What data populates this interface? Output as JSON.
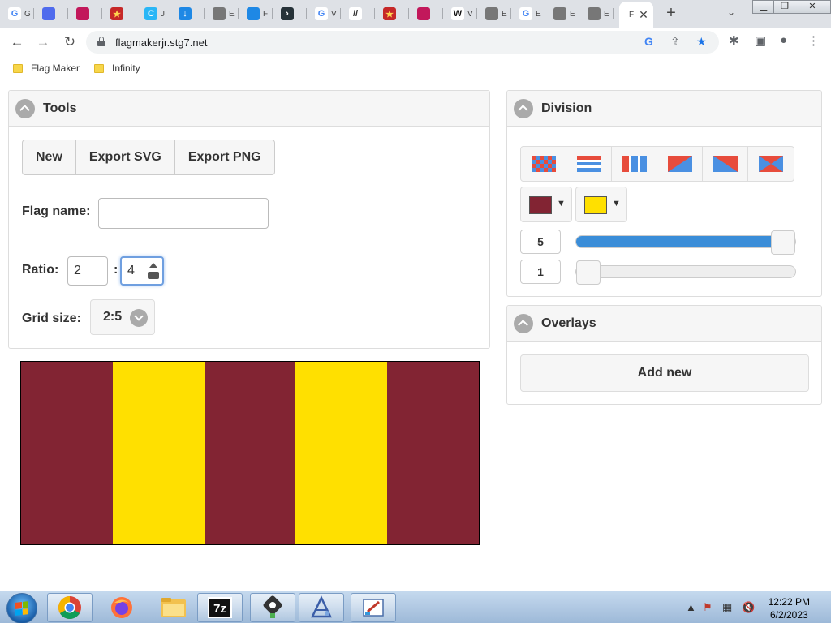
{
  "browser": {
    "tabs": [
      {
        "icon": "google-icon",
        "letter": "G",
        "label": "G",
        "color": "#ffffff",
        "fg": "#4285f4"
      },
      {
        "icon": "teams-icon",
        "letter": "",
        "label": "",
        "color": "#4f6bed",
        "fg": "#ffffff"
      },
      {
        "icon": "tab-icon",
        "letter": "",
        "label": "",
        "color": "#c2185b",
        "fg": "#ffffff"
      },
      {
        "icon": "star-icon",
        "letter": "★",
        "label": "",
        "color": "#c62828",
        "fg": "#ffd54f"
      },
      {
        "icon": "c-icon",
        "letter": "C",
        "label": "J",
        "color": "#29b6f6",
        "fg": "#ffffff"
      },
      {
        "icon": "download-icon",
        "letter": "↓",
        "label": "",
        "color": "#1e88e5",
        "fg": "#ffffff"
      },
      {
        "icon": "globe-icon",
        "letter": "",
        "label": "E",
        "color": "#777777",
        "fg": "#ffffff"
      },
      {
        "icon": "edge-icon",
        "letter": "",
        "label": "F",
        "color": "#1e88e5",
        "fg": "#ffffff"
      },
      {
        "icon": "arrow-icon",
        "letter": "›",
        "label": "",
        "color": "#263238",
        "fg": "#ffffff"
      },
      {
        "icon": "google-icon",
        "letter": "G",
        "label": "V",
        "color": "#ffffff",
        "fg": "#4285f4"
      },
      {
        "icon": "slash-icon",
        "letter": "//",
        "label": "",
        "color": "#ffffff",
        "fg": "#333333"
      },
      {
        "icon": "star-icon",
        "letter": "★",
        "label": "",
        "color": "#c62828",
        "fg": "#ffd54f"
      },
      {
        "icon": "tab-icon",
        "letter": "",
        "label": "",
        "color": "#c2185b",
        "fg": "#ffffff"
      },
      {
        "icon": "wikipedia-icon",
        "letter": "W",
        "label": "V",
        "color": "#ffffff",
        "fg": "#111111"
      },
      {
        "icon": "globe-icon",
        "letter": "",
        "label": "E",
        "color": "#777777",
        "fg": "#ffffff"
      },
      {
        "icon": "google-icon",
        "letter": "G",
        "label": "E",
        "color": "#ffffff",
        "fg": "#4285f4"
      },
      {
        "icon": "globe-icon",
        "letter": "",
        "label": "E",
        "color": "#777777",
        "fg": "#ffffff"
      },
      {
        "icon": "globe-icon",
        "letter": "",
        "label": "E",
        "color": "#777777",
        "fg": "#ffffff"
      }
    ],
    "active_tab": {
      "label": "F",
      "close": "✕"
    },
    "new_tab": "+",
    "tab_search": "⌄",
    "window_controls": {
      "minimize": "▁",
      "maximize": "❐",
      "close": "✕"
    },
    "url": "flagmakerjr.stg7.net",
    "bookmarks": [
      {
        "label": "Flag Maker"
      },
      {
        "label": "Infinity"
      }
    ]
  },
  "tools": {
    "title": "Tools",
    "buttons": {
      "new": "New",
      "export_svg": "Export SVG",
      "export_png": "Export PNG"
    },
    "flag_name_label": "Flag name:",
    "flag_name_value": "",
    "ratio_label": "Ratio:",
    "ratio_height": "2",
    "ratio_sep": ":",
    "ratio_width": "4",
    "grid_label": "Grid size:",
    "grid_value": "2:5"
  },
  "flag": {
    "stripes": [
      "#822433",
      "#ffe000",
      "#822433",
      "#ffe000",
      "#822433"
    ]
  },
  "division": {
    "title": "Division",
    "patterns": [
      "grid",
      "horizontal",
      "vertical",
      "diagonal-left",
      "diagonal-right",
      "x"
    ],
    "color1": "#822433",
    "color2": "#ffe000",
    "dropdown_arrow": "▼",
    "count1": "5",
    "count1_fraction": 1.0,
    "count2": "1",
    "count2_fraction": 0.0
  },
  "overlays": {
    "title": "Overlays",
    "add_new": "Add new"
  },
  "taskbar": {
    "apps": [
      "chrome",
      "firefox",
      "explorer",
      "7zip",
      "inkscape",
      "artweaver",
      "paint"
    ],
    "time": "12:22 PM",
    "date": "6/2/2023"
  }
}
